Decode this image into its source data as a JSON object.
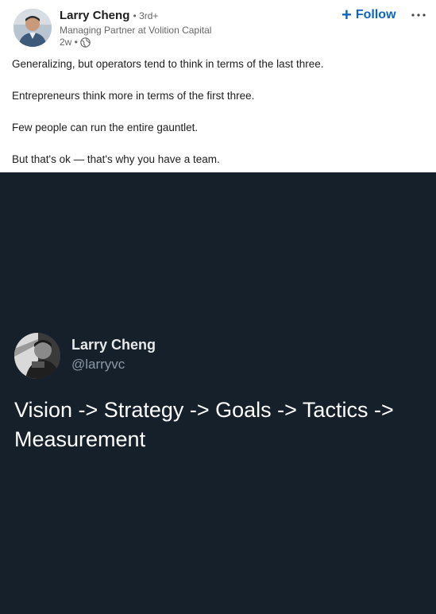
{
  "post": {
    "author": {
      "name": "Larry Cheng",
      "degree": "• 3rd+",
      "headline": "Managing Partner at Volition Capital",
      "time": "2w •"
    },
    "actions": {
      "follow_label": "Follow",
      "follow_icon": "plus-icon",
      "more_icon": "more-options-icon"
    },
    "body": [
      "Generalizing, but operators tend to think in terms of the last three.",
      "Entrepreneurs think more in terms of the first three.",
      "Few people can run the entire gauntlet.",
      "But that's ok — that's why you have a team."
    ]
  },
  "tweet": {
    "name": "Larry Cheng",
    "handle": "@larryvc",
    "text": "Vision -> Strategy -> Goals -> Tactics -> Measurement",
    "background": "#15202b"
  },
  "colors": {
    "link": "#0a66c2",
    "text": "#1d1d1d",
    "muted": "#666666"
  }
}
